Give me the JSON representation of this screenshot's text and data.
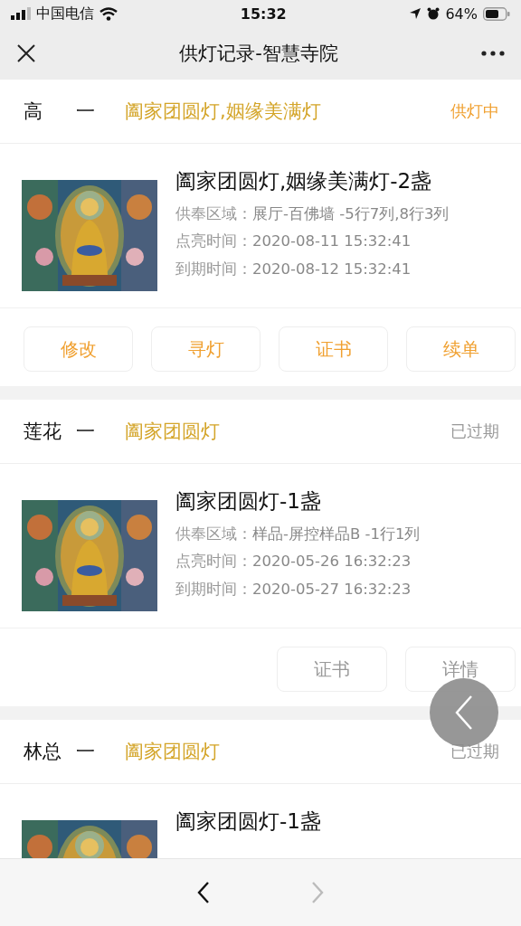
{
  "status_bar": {
    "carrier": "中国电信",
    "time": "15:32",
    "battery": "64%"
  },
  "nav": {
    "title": "供灯记录-智慧寺院"
  },
  "records": [
    {
      "name": "高",
      "dash": "一",
      "lamps": "阖家团圆灯,姻缘美满灯",
      "status": "供灯中",
      "expired": false,
      "item_title": "阖家团圆灯,姻缘美满灯-2盏",
      "details": [
        {
          "label": "供奉区域：",
          "value": "展厅-百佛墙 -5行7列,8行3列"
        },
        {
          "label": "点亮时间：",
          "value": "2020-08-11 15:32:41"
        },
        {
          "label": "到期时间：",
          "value": "2020-08-12 15:32:41"
        }
      ],
      "buttons": [
        "修改",
        "寻灯",
        "证书",
        "续单"
      ]
    },
    {
      "name": "莲花",
      "dash": "一",
      "lamps": "阖家团圆灯",
      "status": "已过期",
      "expired": true,
      "item_title": "阖家团圆灯-1盏",
      "details": [
        {
          "label": "供奉区域：",
          "value": "样品-屏控样品B -1行1列"
        },
        {
          "label": "点亮时间：",
          "value": "2020-05-26 16:32:23"
        },
        {
          "label": "到期时间：",
          "value": "2020-05-27 16:32:23"
        }
      ],
      "buttons": [
        "证书",
        "详情"
      ]
    },
    {
      "name": "林总",
      "dash": "一",
      "lamps": "阖家团圆灯",
      "status": "已过期",
      "expired": true,
      "item_title": "阖家团圆灯-1盏"
    }
  ],
  "bottom_bar": {
    "back_disabled": false,
    "forward_disabled": true
  }
}
